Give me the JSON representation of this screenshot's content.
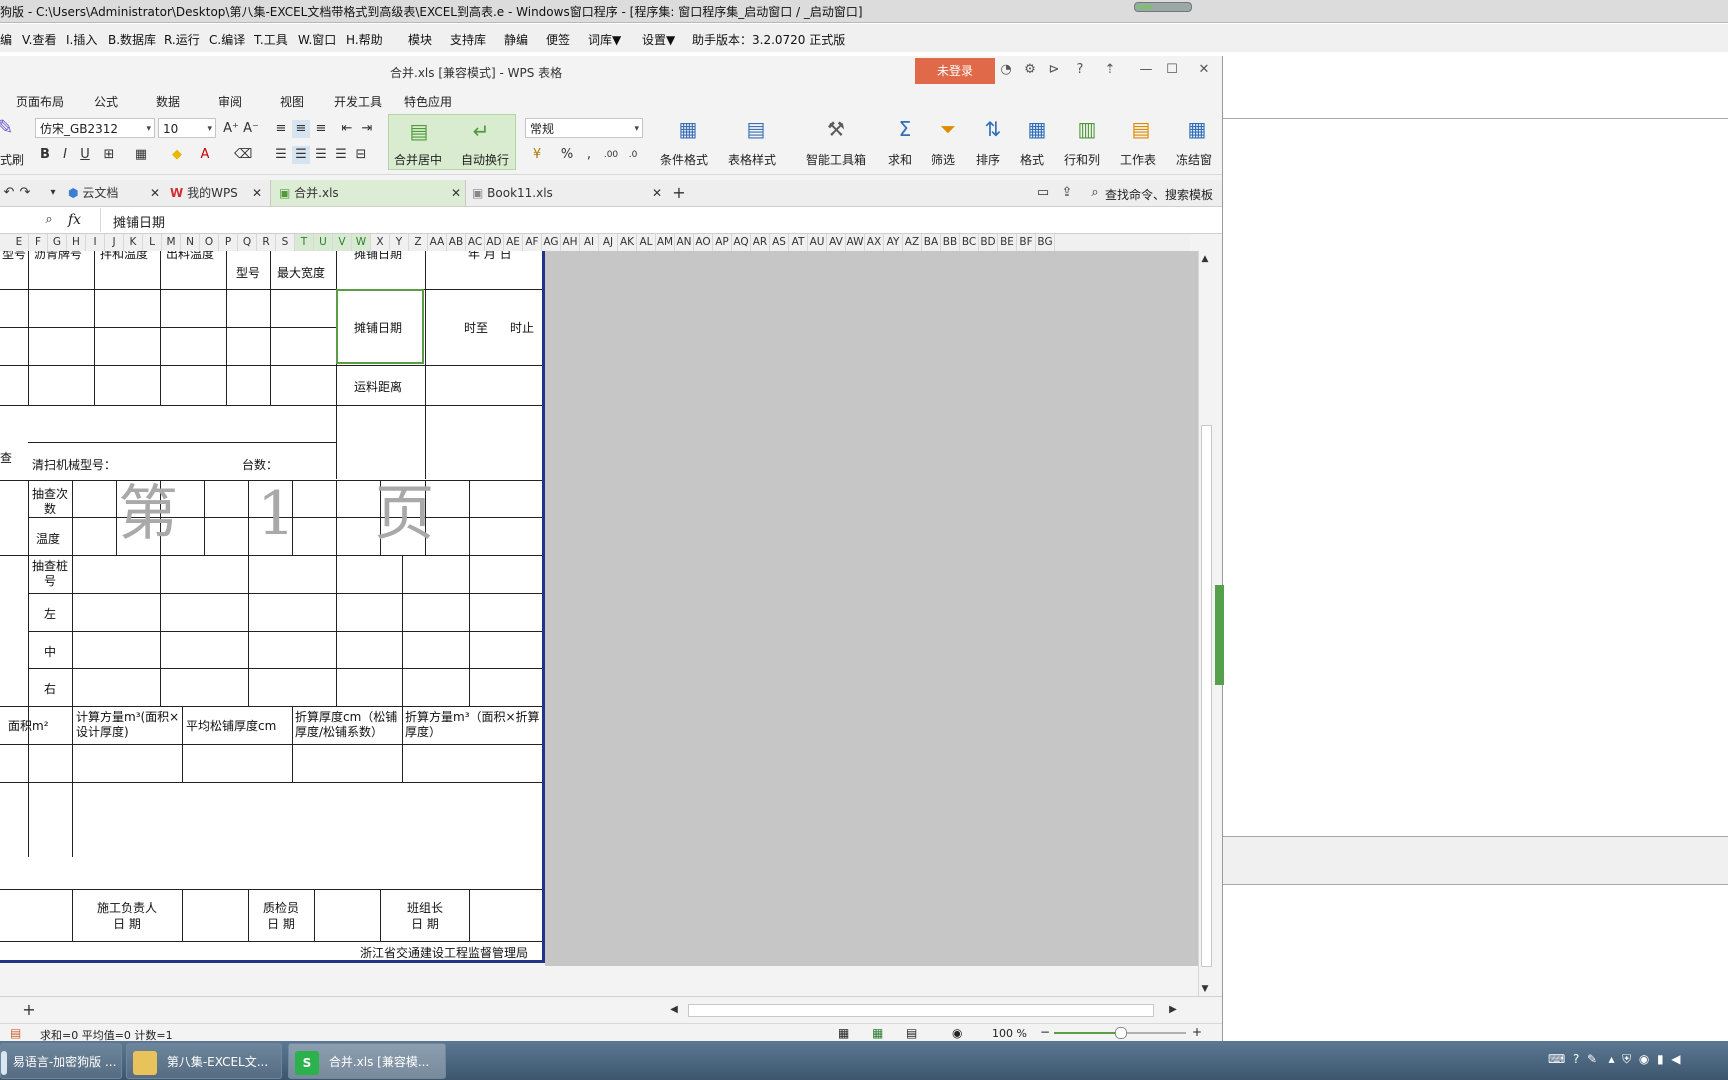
{
  "ide": {
    "title": "狗版 - C:\\Users\\Administrator\\Desktop\\第八集-EXCEL文档带格式到高级表\\EXCEL到高表.e - Windows窗口程序 - [程序集: 窗口程序集_启动窗口 / _启动窗口]",
    "menu": [
      "编",
      "V.查看",
      "I.插入",
      "B.数据库",
      "R.运行",
      "C.编译",
      "T.工具",
      "W.窗口",
      "H.帮助",
      "模块",
      "支持库",
      "静编",
      "便签",
      "词库▼",
      "设置▼",
      "助手版本：3.2.0720 正式版"
    ]
  },
  "wps": {
    "title": "合并.xls [兼容模式] - WPS 表格",
    "login_label": "未登录",
    "ribbon_tabs": [
      "页面布局",
      "公式",
      "数据",
      "审阅",
      "视图",
      "开发工具",
      "特色应用"
    ],
    "font_name": "仿宋_GB2312",
    "font_size": "10",
    "number_format": "常规",
    "merge_label": "合并居中",
    "wrap_label": "自动换行",
    "format_brush": "式刷",
    "big_buttons": [
      "条件格式",
      "表格样式",
      "智能工具箱",
      "求和",
      "筛选",
      "排序",
      "格式",
      "行和列",
      "工作表",
      "冻结窗"
    ],
    "doc_tabs": [
      "云文档",
      "我的WPS",
      "合并.xls",
      "Book11.xls"
    ],
    "search_label": "查找命令、搜索模板",
    "fx_label": "fx",
    "formula_value": "摊铺日期",
    "columns": [
      "E",
      "F",
      "G",
      "H",
      "I",
      "J",
      "K",
      "L",
      "M",
      "N",
      "O",
      "P",
      "Q",
      "R",
      "S",
      "T",
      "U",
      "V",
      "W",
      "X",
      "Y",
      "Z",
      "AA",
      "AB",
      "AC",
      "AD",
      "AE",
      "AF",
      "AG",
      "AH",
      "AI",
      "AJ",
      "AK",
      "AL",
      "AM",
      "AN",
      "AO",
      "AP",
      "AQ",
      "AR",
      "AS",
      "AT",
      "AU",
      "AV",
      "AW",
      "AX",
      "AY",
      "AZ",
      "BA",
      "BB",
      "BC",
      "BD",
      "BE",
      "BF",
      "BG"
    ],
    "status_text": "求和=0  平均值=0  计数=1",
    "zoom": "100 %",
    "zoom_level": 0.5
  },
  "sheet": {
    "top_row": [
      "型号",
      "沥青牌号",
      "拌和温度",
      "出料温度",
      "型号",
      "最大宽度",
      "摊铺日期",
      "年  月  日"
    ],
    "selected_cell": "摊铺日期",
    "time_from": "时至",
    "time_to": "时止",
    "haul_distance": "运料距离",
    "inspect_label": "查",
    "sweeper_label": "清扫机械型号：",
    "count_label": "台数：",
    "sample_count": "抽查次数",
    "temperature": "温度",
    "sample_station": "抽查桩号",
    "left": "左",
    "middle": "中",
    "right": "右",
    "watermark": "第 1 页",
    "bottom_headers": [
      "面积m²",
      "计算方量m³(面积×设计厚度)",
      "平均松铺厚度cm",
      "折算厚度cm（松铺厚度/松铺系数）",
      "折算方量m³（面积×折算厚度）"
    ],
    "signers": [
      {
        "role": "施工负责人",
        "date": "日  期"
      },
      {
        "role": "质检员",
        "date": "日  期"
      },
      {
        "role": "班组长",
        "date": "日  期"
      }
    ],
    "footer": "浙江省交通建设工程监督管理局"
  },
  "taskbar": {
    "items": [
      "易语言-加密狗版 ...",
      "第八集-EXCEL文...",
      "合并.xls [兼容模..."
    ]
  }
}
